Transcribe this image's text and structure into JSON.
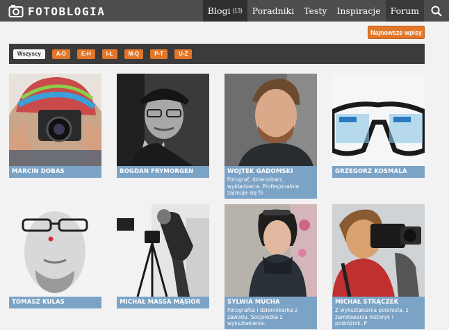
{
  "header": {
    "logo_text": "FOTOBLOGIA",
    "nav": [
      {
        "label": "Blogi",
        "count": "(13)"
      },
      {
        "label": "Poradniki"
      },
      {
        "label": "Testy"
      },
      {
        "label": "Inspiracje"
      },
      {
        "label": "Forum"
      }
    ],
    "search_icon": "search-icon"
  },
  "newest_button": "Najnowsze wpisy",
  "filters": [
    "Wszyscy",
    "A-D",
    "E-H",
    "I-Ł",
    "M-Q",
    "P-T",
    "U-Ż"
  ],
  "bloggers": [
    {
      "name": "MARCIN DOBAS",
      "desc": ""
    },
    {
      "name": "BOGDAN FRYMORGEN",
      "desc": ""
    },
    {
      "name": "WOJTEK GADOMSKI",
      "desc": "Fotograf, dziennikarz, wykładowca. Profesjonalnie zajmuje się fo"
    },
    {
      "name": "GRZEGORZ KOSMALA",
      "desc": ""
    },
    {
      "name": "TOMASZ KULAS",
      "desc": ""
    },
    {
      "name": "MICHAŁ MASSA MĄSIOR",
      "desc": ""
    },
    {
      "name": "SYLWIA MUCHA",
      "desc": "Fotografka i dziennikarka z zawodu. Socjolożka z wykształcenia."
    },
    {
      "name": "MICHAŁ STRĄCZEK",
      "desc": "Z wykształcenia polonista, z zamiłowania historyk i podróżnik. P"
    }
  ],
  "colors": {
    "topbar": "#4d4d4d",
    "accent_orange": "#e0772a",
    "caption_blue": "#7ba3c6",
    "filterbar": "#3b3b3b"
  }
}
